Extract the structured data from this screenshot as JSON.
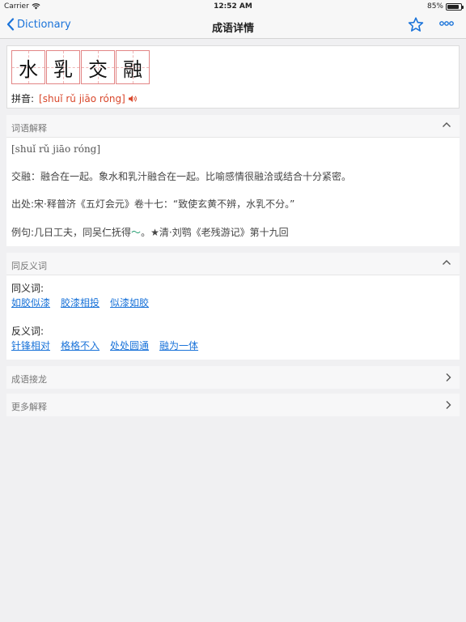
{
  "status_bar": {
    "carrier": "Carrier",
    "time": "12:52 AM",
    "battery_text": "85%",
    "battery_level": 0.85
  },
  "nav": {
    "back_label": "Dictionary",
    "title": "成语详情"
  },
  "idiom": {
    "characters": [
      "水",
      "乳",
      "交",
      "融"
    ],
    "pinyin_label": "拼音:",
    "pinyin": "[shuǐ rǔ jiāo róng]"
  },
  "explanation": {
    "title": "词语解释",
    "pinyin": "[shuǐ rǔ jiāo róng]",
    "definition": "交融：融合在一起。象水和乳汁融合在一起。比喻感情很融洽或结合十分紧密。",
    "source": "出处:宋·释普济《五灯会元》卷十七：“致使玄黄不辨，水乳不分。”",
    "example_before": "例句:几日工夫，同吴仁抚得",
    "example_tilde": "～",
    "example_after": "。★清·刘鹗《老残游记》第十九回"
  },
  "synonyms": {
    "title": "同反义词",
    "syn_label": "同义词:",
    "syn_items": [
      "如胶似漆",
      "胶漆相投",
      "似漆如胶"
    ],
    "ant_label": "反义词:",
    "ant_items": [
      "针锋相对",
      "格格不入",
      "处处圆通",
      "融为一体"
    ]
  },
  "chain": {
    "title": "成语接龙"
  },
  "more": {
    "title": "更多解释"
  },
  "colors": {
    "accent": "#1a73d9",
    "pinyin_red": "#d9472b",
    "grid_red": "#e28585",
    "tilde_green": "#1a9a6b"
  }
}
